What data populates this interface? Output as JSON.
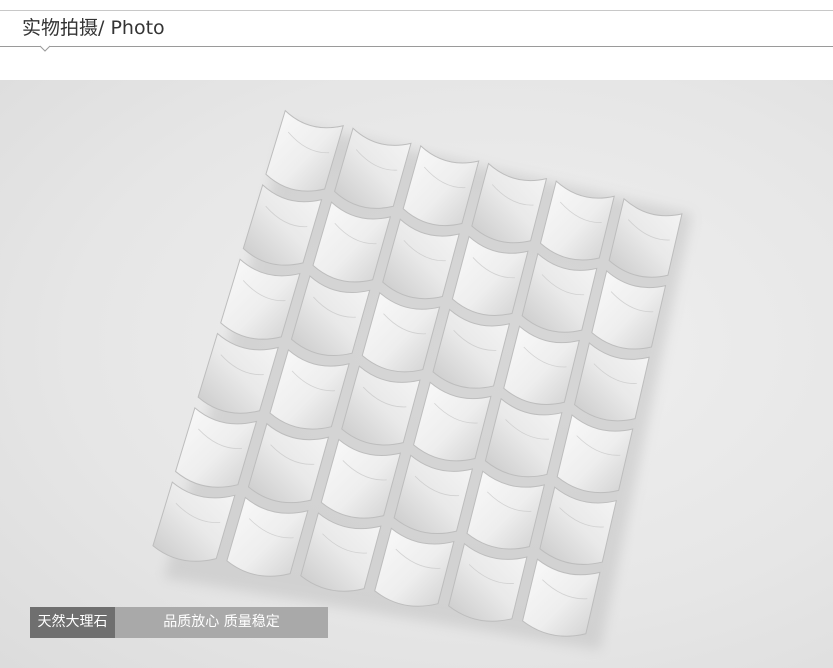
{
  "section": {
    "title": "实物拍摄/ Photo"
  },
  "photo": {
    "subject": "white-marble-mosaic-tile-sheet",
    "grid": {
      "rows": 6,
      "cols": 6
    }
  },
  "caption": {
    "material": "天然大理石",
    "slogan": "品质放心 质量稳定"
  },
  "colors": {
    "title_text": "#333333",
    "rule": "#9a9a9a",
    "caption_dark": "#6f6f6f",
    "caption_light": "#a9a9a9"
  }
}
